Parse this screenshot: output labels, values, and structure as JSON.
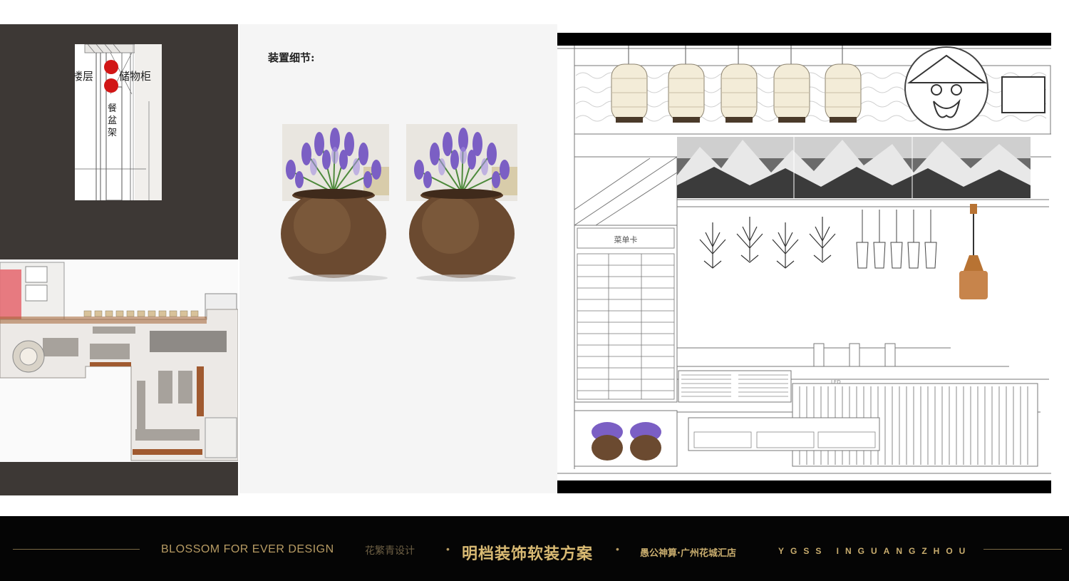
{
  "section": {
    "title": "装置细节:"
  },
  "mini_plan": {
    "label_left": "楼层",
    "label_right": "储物柜",
    "label_vertical": "餐盆架"
  },
  "elevation": {
    "menu_header": "菜单卡",
    "led_label": "LED"
  },
  "footer": {
    "brand": "BLOSSOM FOR EVER DESIGN",
    "brand_cn": "花繁青设计",
    "dot": "•",
    "title": "明档装饰软装方案",
    "store": "愚公神算·广州花城汇店",
    "code": "YGSS INGUANGZHOU"
  },
  "colors": {
    "dark_panel": "#3d3835",
    "footer_bg": "#050505",
    "gold": "#c9ad6e",
    "lavender": "#7b5fc4",
    "pot": "#6b4a30"
  }
}
